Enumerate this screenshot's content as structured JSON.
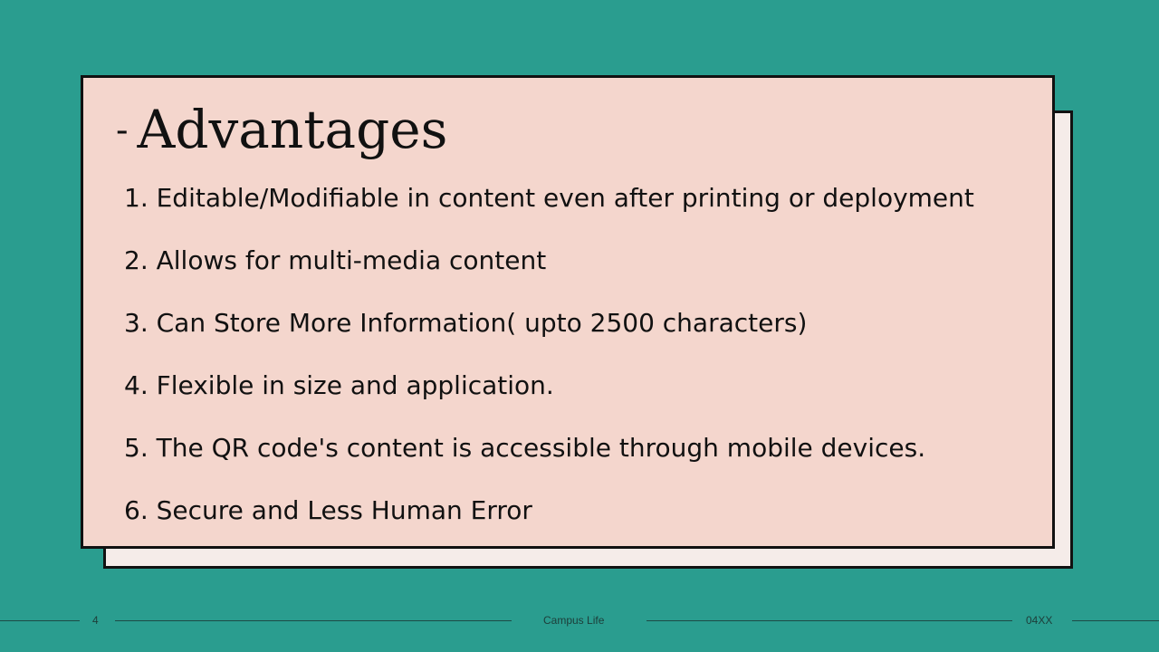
{
  "slide": {
    "title_dash": "-",
    "title": "Advantages",
    "items": [
      "1. Editable/Modifiable in content even after printing or deployment",
      "2. Allows for multi-media content",
      "3. Can Store More Information( upto 2500 characters)",
      "4. Flexible in size and application.",
      "5. The QR code's content is accessible through mobile devices.",
      "6. Secure and Less Human Error"
    ]
  },
  "footer": {
    "page_number": "4",
    "center_text": "Campus Life",
    "right_text": "04XX"
  },
  "colors": {
    "background": "#2a9d8f",
    "front_card": "#f4d6cd",
    "back_card": "#f5ece9",
    "border": "#111111"
  }
}
